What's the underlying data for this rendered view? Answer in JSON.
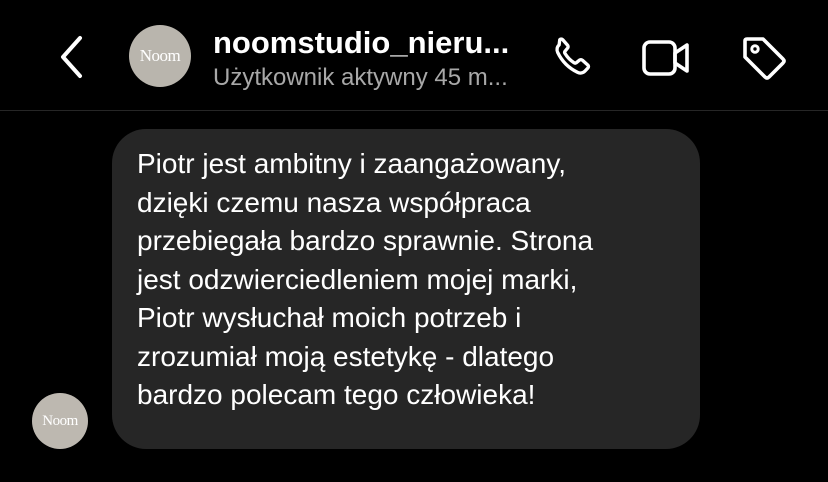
{
  "header": {
    "username": "noomstudio_nieru...",
    "status": "Użytkownik aktywny 45 m...",
    "avatar_text": "Noom",
    "back_icon": "chevron-left-icon",
    "call_icon": "phone-icon",
    "video_icon": "video-camera-icon",
    "tag_icon": "tag-icon"
  },
  "conversation": {
    "messages": [
      {
        "sender_avatar_text": "Noom",
        "text": "Piotr jest ambitny i zaangażowany,\ndzięki czemu nasza współpraca\nprzebiegała bardzo sprawnie. Strona\njest odzwierciedleniem mojej marki,\nPiotr wysłuchał moich potrzeb i\nzrozumiał moją estetykę - dlatego\nbardzo polecam tego człowieka!"
      }
    ]
  },
  "colors": {
    "background": "#000000",
    "bubble": "#262626",
    "text_primary": "#ffffff",
    "text_secondary": "#a8a8a8",
    "avatar": "#b9b5ad"
  }
}
